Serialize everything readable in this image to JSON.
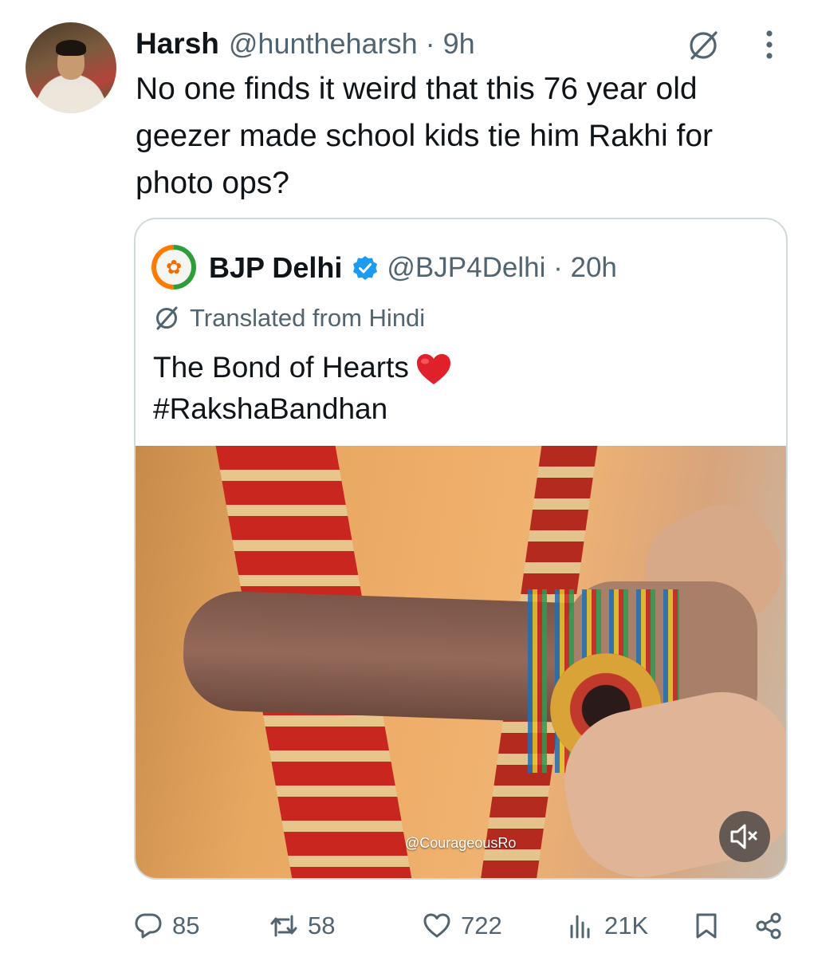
{
  "tweet": {
    "author_name": "Harsh",
    "author_handle": "@huntheharsh",
    "separator": "·",
    "time": "9h",
    "text": "No one finds it weird that this 76 year old geezer made school kids tie him Rakhi for photo ops?",
    "icons": [
      "grok-icon",
      "more-options-icon"
    ]
  },
  "quote": {
    "author_name": "BJP Delhi",
    "author_handle": "@BJP4Delhi",
    "separator": "·",
    "time": "20h",
    "verified": true,
    "translated_label": "Translated from Hindi",
    "text_line1": "The Bond of Hearts",
    "emoji": "red-heart",
    "text_line2": "#RakshaBandhan",
    "media": {
      "watermark": "@CourageousRo",
      "muted": true
    }
  },
  "actions": {
    "replies": "85",
    "reposts": "58",
    "likes": "722",
    "views": "21K"
  },
  "colors": {
    "text": "#0f1419",
    "secondary": "#536471",
    "border": "#cfd9de",
    "verified": "#1d9bf0"
  }
}
